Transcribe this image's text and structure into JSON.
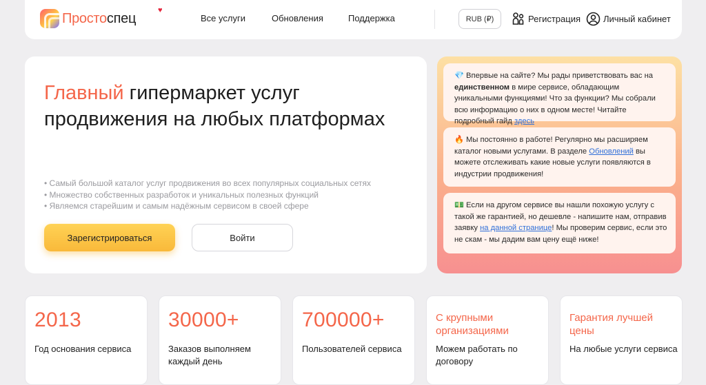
{
  "header": {
    "logo": {
      "part1": "Просто",
      "part2": "спец"
    },
    "nav": [
      "Все услуги",
      "Обновления",
      "Поддержка"
    ],
    "currency": "RUB (₽)",
    "register": "Регистрация",
    "account": "Личный кабинет"
  },
  "hero": {
    "title_highlight": "Главный",
    "title_rest": " гипермаркет услуг продвижения на любых платформах",
    "bullets": [
      "Самый большой каталог услуг продвижения во всех популярных социальных сетях",
      "Множество собственных разработок и уникальных полезных функций",
      "Являемся старейшим и самым надёжным сервисом в своей сфере"
    ],
    "register_button": "Зарегистрироваться",
    "login_button": "Войти"
  },
  "info": {
    "card1": {
      "emoji": "💎",
      "text1": " Впервые на сайте? Мы рады приветствовать вас на ",
      "bold": "единственном",
      "text2": " в мире сервисе, обладающим уникальными функциями! Что за функции? Мы собрали всю информацию о них в одном месте! Читайте подробный гайд ",
      "link": "здесь"
    },
    "card2": {
      "emoji": "🔥",
      "text1": " Мы постоянно в работе! Регулярно мы расширяем каталог новыми услугами. В разделе ",
      "link": "Обновлений",
      "text2": " вы можете отслеживать какие новые услуги появляются в индустрии продвижения!"
    },
    "card3": {
      "emoji": "💵",
      "text1": " Если на другом сервисе вы нашли похожую услугу с такой же гарантией, но дешевле - напишите нам, отправив заявку ",
      "link": "на данной странице",
      "text2": "! Мы проверим сервис, если это не скам - мы дадим вам цену ещё ниже!"
    }
  },
  "stats": [
    {
      "value": "2013",
      "desc": "Год основания сервиса"
    },
    {
      "value": "30000+",
      "desc": "Заказов выполняем каждый день"
    },
    {
      "value": "700000+",
      "desc": "Пользователей сервиса"
    },
    {
      "value": "С крупными организациями",
      "desc": "Можем работать по договору"
    },
    {
      "value": "Гарантия лучшей цены",
      "desc": "На любые услуги сервиса"
    }
  ],
  "colors": {
    "accent": "#f4664a",
    "button": "#f9b93a",
    "link": "#2f6fd8"
  }
}
